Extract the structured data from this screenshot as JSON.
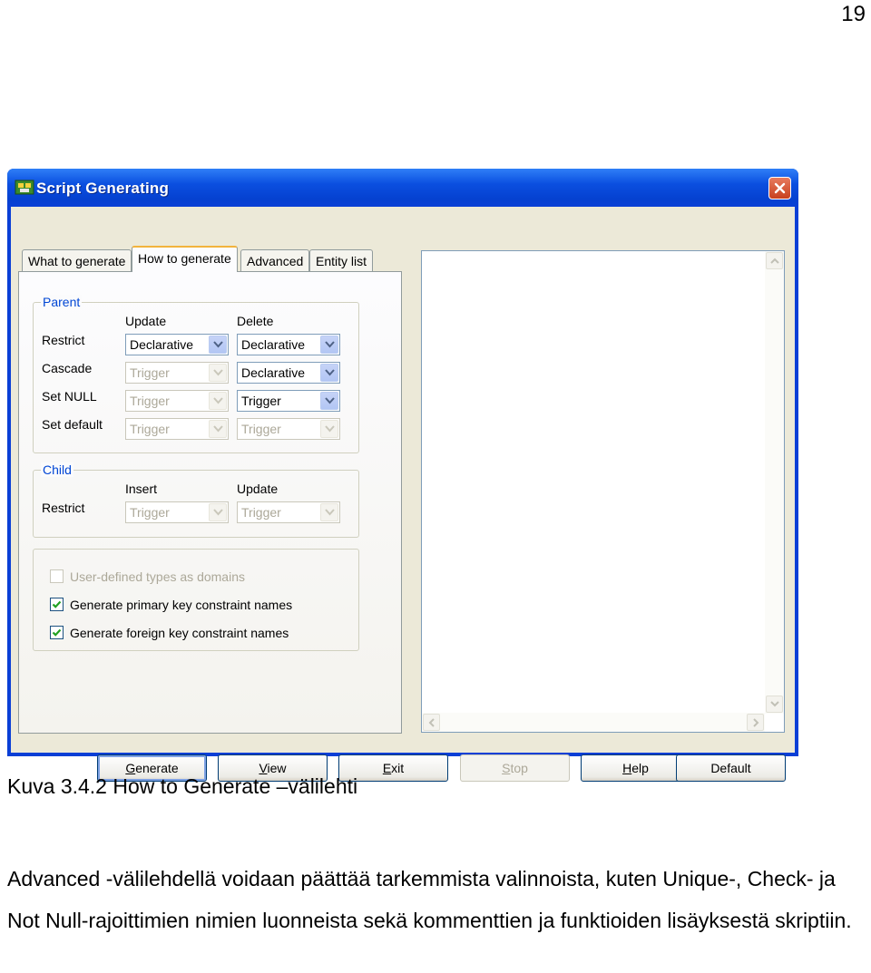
{
  "page_number": "19",
  "window": {
    "title": "Script Generating",
    "tabs": [
      "What to generate",
      "How to generate",
      "Advanced",
      "Entity list"
    ],
    "active_tab": "How to generate"
  },
  "parent_group": {
    "label": "Parent",
    "col_update": "Update",
    "col_delete": "Delete",
    "rows": [
      {
        "label": "Restrict",
        "update": "Declarative",
        "update_enabled": true,
        "delete": "Declarative",
        "delete_enabled": true
      },
      {
        "label": "Cascade",
        "update": "Trigger",
        "update_enabled": false,
        "delete": "Declarative",
        "delete_enabled": true
      },
      {
        "label": "Set NULL",
        "update": "Trigger",
        "update_enabled": false,
        "delete": "Trigger",
        "delete_enabled": true
      },
      {
        "label": "Set default",
        "update": "Trigger",
        "update_enabled": false,
        "delete": "Trigger",
        "delete_enabled": false
      }
    ]
  },
  "child_group": {
    "label": "Child",
    "col_insert": "Insert",
    "col_update": "Update",
    "row_label": "Restrict",
    "insert": "Trigger",
    "update": "Trigger"
  },
  "options": [
    {
      "label": "User-defined types as domains",
      "checked": false,
      "enabled": false
    },
    {
      "label": "Generate primary key constraint names",
      "checked": true,
      "enabled": true
    },
    {
      "label": "Generate foreign key constraint names",
      "checked": true,
      "enabled": true
    }
  ],
  "buttons": {
    "generate": {
      "first": "G",
      "rest": "enerate"
    },
    "view": {
      "first": "V",
      "rest": "iew"
    },
    "exit": {
      "first": "E",
      "rest": "xit"
    },
    "stop": {
      "first": "S",
      "rest": "top"
    },
    "help": {
      "first": "H",
      "rest": "elp"
    },
    "default": "Default"
  },
  "caption": "Kuva 3.4.2 How to Generate –välilehti",
  "body_text": "Advanced -välilehdellä voidaan päättää tarkemmista valinnoista, kuten Unique-, Check- ja Not Null-rajoittimien nimien luonneista sekä kommenttien ja funktioiden lisäyksestä skriptiin.",
  "colors": {
    "title_bar": "#0a3fd6",
    "group_label": "#0046d5",
    "active_tab_accent": "#f2b33d",
    "face": "#ece9d8"
  }
}
